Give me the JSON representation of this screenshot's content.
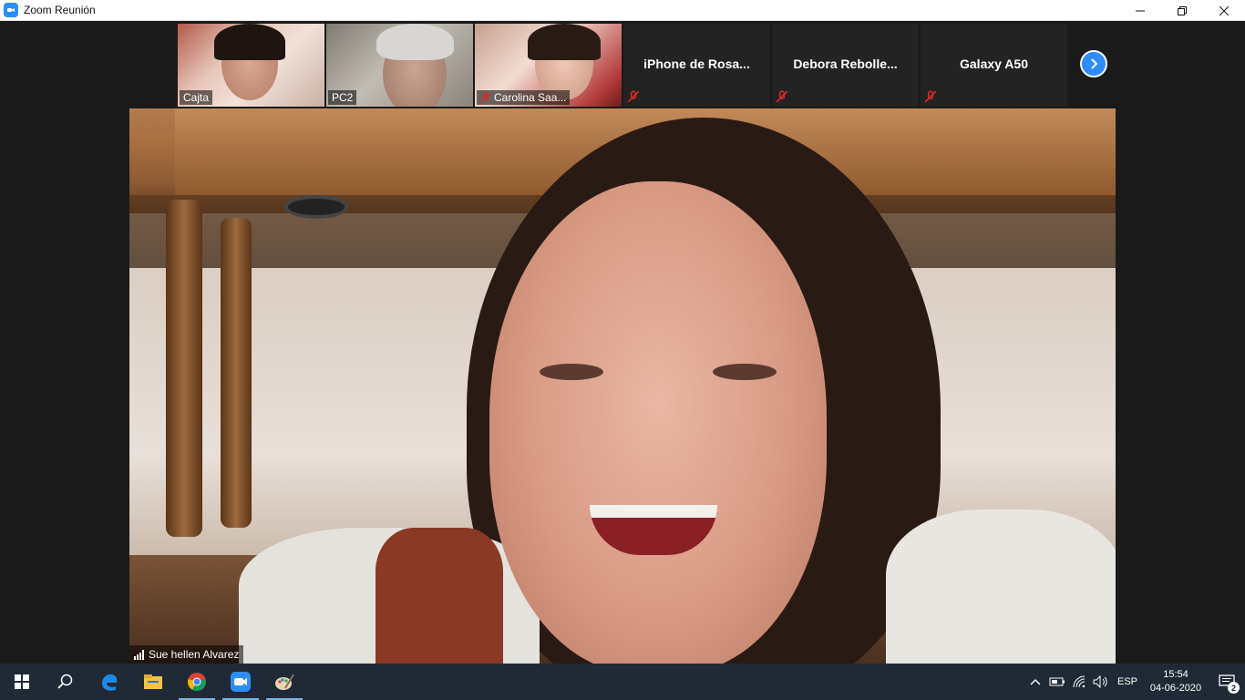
{
  "window": {
    "title": "Zoom Reunión",
    "app_icon": "zoom-icon",
    "controls": [
      "minimize-icon",
      "restore-icon",
      "close-icon"
    ]
  },
  "participants": [
    {
      "name": "Cajta",
      "video": true,
      "muted": false
    },
    {
      "name": "PC2",
      "video": true,
      "muted": false
    },
    {
      "name": "Carolina Saa...",
      "video": true,
      "muted": true
    },
    {
      "name": "iPhone de Rosa...",
      "video": false,
      "muted": true
    },
    {
      "name": "Debora  Rebolle...",
      "video": false,
      "muted": true
    },
    {
      "name": "Galaxy A50",
      "video": false,
      "muted": true
    }
  ],
  "strip_next_icon": "chevron-right-icon",
  "active_speaker": {
    "name": "Sue hellen Alvarez",
    "signal_icon": "signal-bars-icon"
  },
  "taskbar": {
    "items": [
      "windows-start-icon",
      "search-icon",
      "edge-icon",
      "file-explorer-icon",
      "chrome-icon",
      "zoom-icon",
      "paint-icon"
    ],
    "active": [
      "chrome-icon",
      "zoom-icon",
      "paint-icon"
    ],
    "tray": {
      "icons": [
        "chevron-up-icon",
        "battery-icon",
        "wifi-icon",
        "volume-icon"
      ],
      "language": "ESP",
      "time": "15:54",
      "date": "04-06-2020",
      "notifications": "2"
    }
  },
  "colors": {
    "zoom_blue": "#2d8cff",
    "mute_red": "#e02828",
    "taskbar_bg": "#1f2a36",
    "meeting_bg": "#1a1a1a"
  }
}
